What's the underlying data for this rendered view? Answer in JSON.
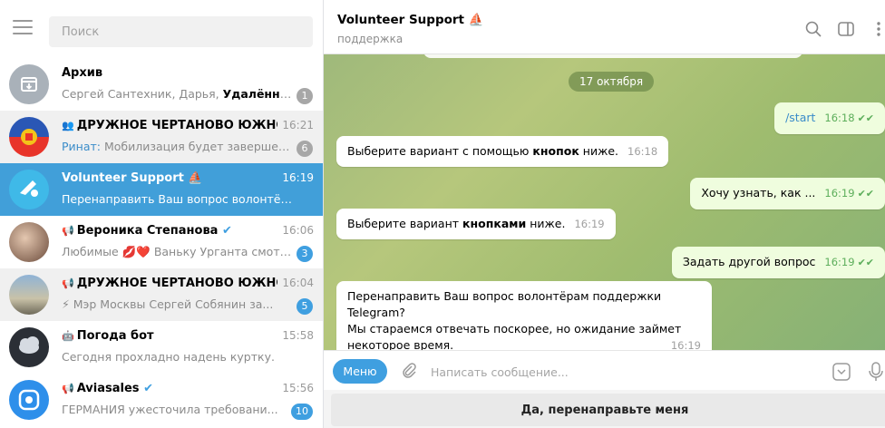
{
  "sidebar": {
    "search_placeholder": "Поиск",
    "chats": [
      {
        "name": "Архив",
        "time": "",
        "preview_plain": "Сергей Сантехник, Дарья, ",
        "preview_bold": "Удалённый а...",
        "badge": "1"
      },
      {
        "name": "ДРУЖНОЕ ЧЕРТАНОВО ЮЖНОЕ",
        "time": "16:21",
        "sender": "Ринат:",
        "preview": " Мобилизация будет завершена ...",
        "badge": "6"
      },
      {
        "name": "Volunteer Support",
        "time": "16:19",
        "preview": "Перенаправить Ваш вопрос волонтёрам п..."
      },
      {
        "name": "Вероника Степанова",
        "time": "16:06",
        "preview": "Любимые 💋❤️ Ваньку Урганта смотр...",
        "badge": "3"
      },
      {
        "name": "ДРУЖНОЕ ЧЕРТАНОВО ЮЖНОЕ",
        "time": "16:04",
        "preview": "⚡ Мэр Москвы Сергей Собянин за...",
        "badge": "5"
      },
      {
        "name": "Погода бот",
        "time": "15:58",
        "preview": "Сегодня прохладно надень куртку."
      },
      {
        "name": "Aviasales",
        "time": "15:56",
        "preview": "ГЕРМАНИЯ ужесточила требовани...",
        "badge": "10"
      }
    ]
  },
  "chat": {
    "title": "Volunteer Support",
    "status": "поддержка",
    "date_divider": "17 октября",
    "messages": [
      {
        "dir": "out",
        "text": "/start",
        "time": "16:18"
      },
      {
        "dir": "in",
        "text_before": "Выберите вариант с помощью ",
        "text_bold": "кнопок",
        "text_after": " ниже.",
        "time": "16:18"
      },
      {
        "dir": "out",
        "text": "Хочу узнать, как ...",
        "time": "16:19"
      },
      {
        "dir": "in",
        "text_before": "Выберите вариант ",
        "text_bold": "кнопками",
        "text_after": " ниже.",
        "time": "16:19"
      },
      {
        "dir": "out",
        "text": "Задать другой вопрос",
        "time": "16:19"
      },
      {
        "dir": "in",
        "line1": "Перенаправить Ваш вопрос волонтёрам поддержки Telegram?",
        "line2": "Мы стараемся отвечать поскорее, но ожидание займет",
        "line3": "некоторое время.",
        "time": "16:19"
      }
    ],
    "menu_button": "Меню",
    "input_placeholder": "Написать сообщение...",
    "reply_keyboard_button": "Да, перенаправьте меня"
  },
  "colors": {
    "accent": "#419fd9",
    "out_bubble": "#effdde",
    "read_check": "#5dae5b"
  }
}
